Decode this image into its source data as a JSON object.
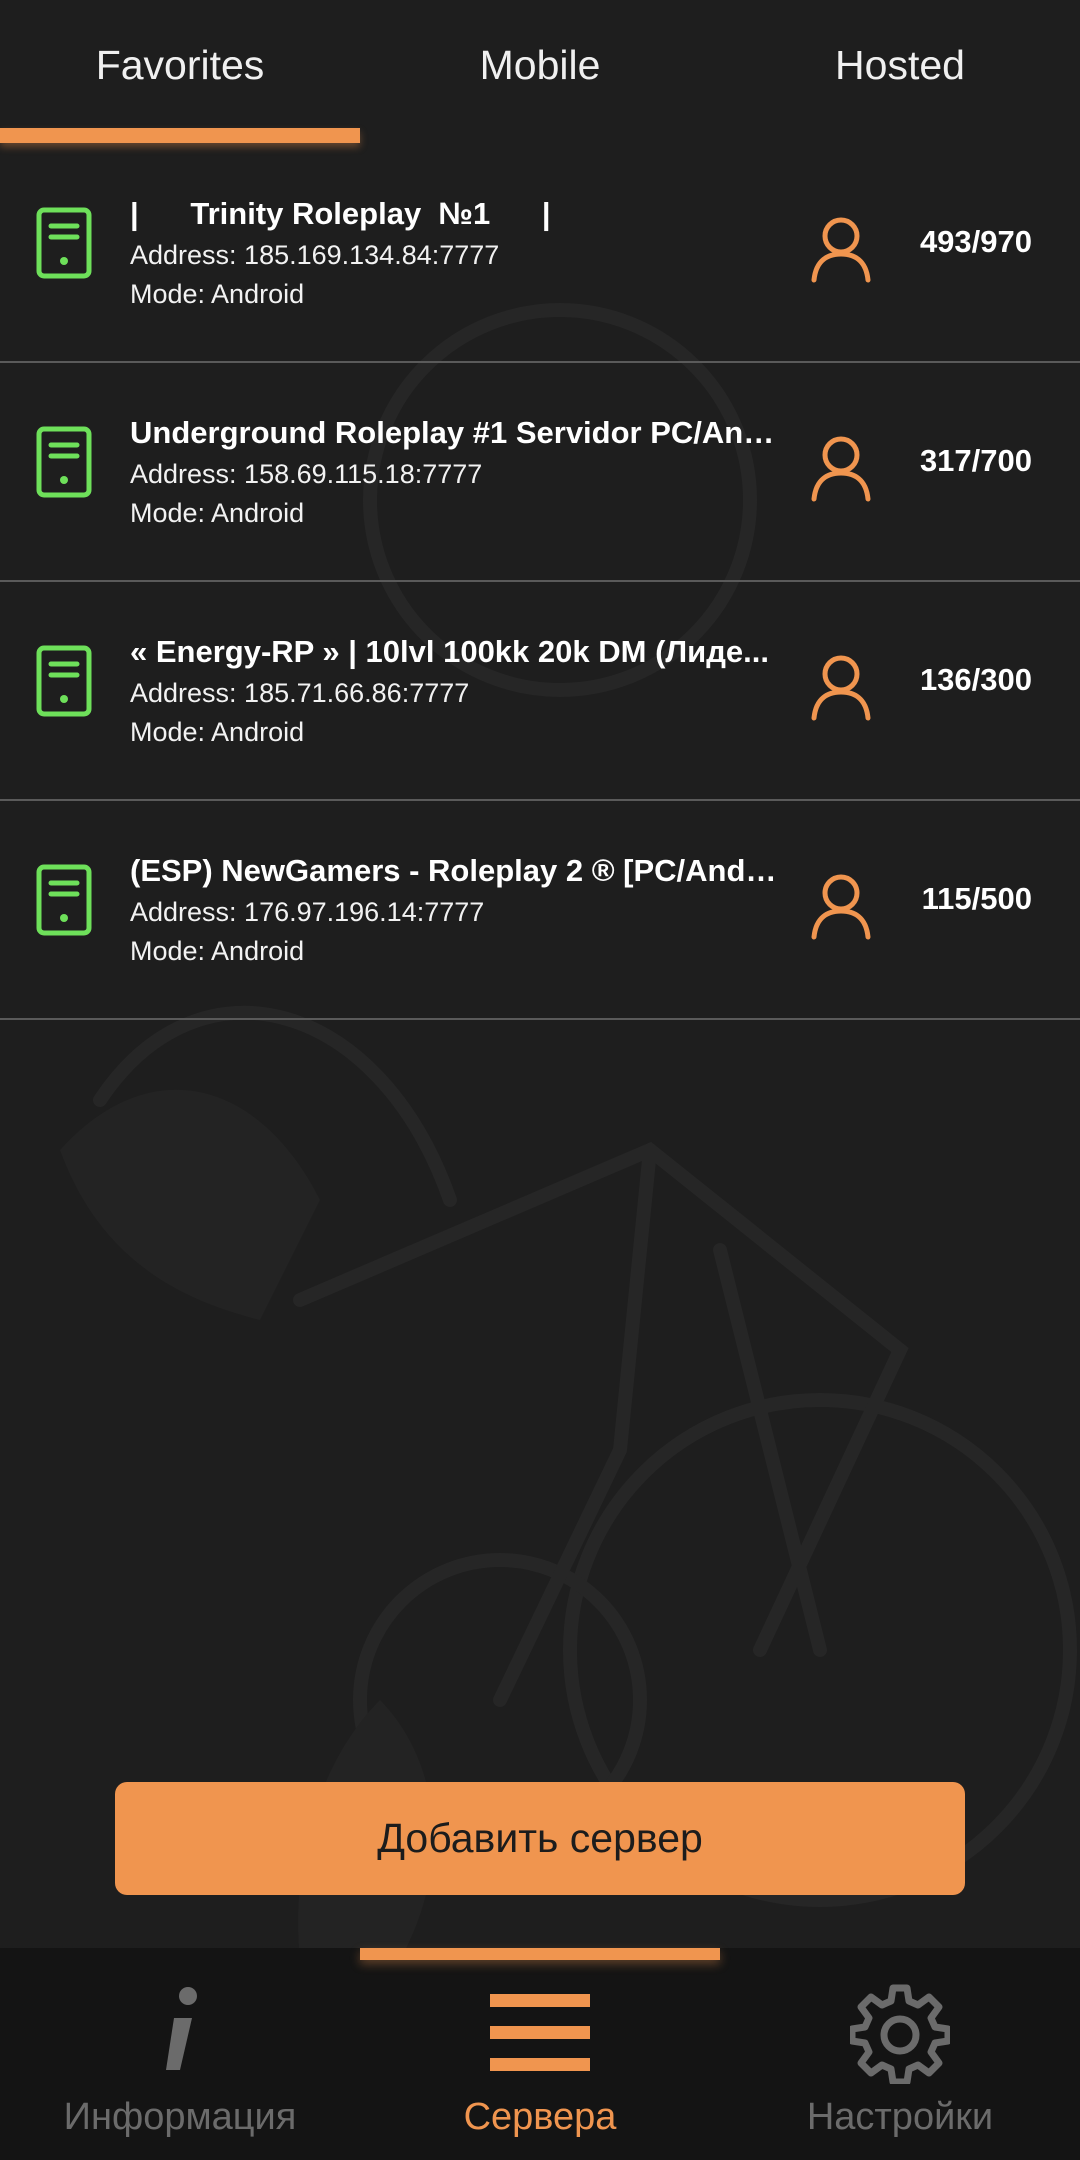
{
  "tabs": {
    "items": [
      {
        "label": "Favorites",
        "active": true
      },
      {
        "label": "Mobile",
        "active": false
      },
      {
        "label": "Hosted",
        "active": false
      }
    ],
    "accent_color": "#f0954f"
  },
  "servers": [
    {
      "name": "|      Trinity Roleplay  №1      |",
      "address": "Address: 185.169.134.84:7777",
      "mode": "Mode: Android",
      "players": "493/970"
    },
    {
      "name": "Underground Roleplay #1 Servidor PC/Andr...",
      "address": "Address: 158.69.115.18:7777",
      "mode": "Mode: Android",
      "players": "317/700"
    },
    {
      "name": "« Energy-RP » | 10lvl 100kk 20k DM (Лиде...",
      "address": "Address: 185.71.66.86:7777",
      "mode": "Mode: Android",
      "players": "136/300"
    },
    {
      "name": "(ESP) NewGamers - Roleplay 2 ® [PC/Andr...",
      "address": "Address: 176.97.196.14:7777",
      "mode": "Mode: Android",
      "players": "115/500"
    }
  ],
  "icons": {
    "server": "server-icon",
    "players": "user-icon"
  },
  "colors": {
    "server_icon": "#6ee05a",
    "accent": "#f0954f",
    "inactive": "#6b6b6b"
  },
  "add_button": {
    "label": "Добавить сервер"
  },
  "bottom_nav": {
    "items": [
      {
        "label": "Информация",
        "icon": "info-icon",
        "active": false
      },
      {
        "label": "Сервера",
        "icon": "menu-icon",
        "active": true
      },
      {
        "label": "Настройки",
        "icon": "gear-icon",
        "active": false
      }
    ]
  }
}
